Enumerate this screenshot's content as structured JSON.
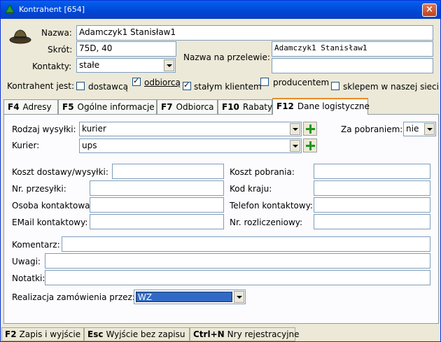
{
  "window": {
    "title": "Kontrahent [654]",
    "close": "×"
  },
  "header": {
    "nazwa_label": "Nazwa:",
    "nazwa_value": "Adamczyk1 Stanisław1",
    "skrot_label": "Skrót:",
    "skrot_value": "75D, 40",
    "kontakty_label": "Kontakty:",
    "kontakty_value": "stałe",
    "przelew_label": "Nazwa na przelewie:",
    "przelew_value": "Adamczyk1 Stanisław1",
    "przelew_value2": ""
  },
  "kontrahent_jest": {
    "label": "Kontrahent jest:",
    "options": [
      {
        "label": "dostawcą",
        "checked": false
      },
      {
        "label": "odbiorcą",
        "checked": true
      },
      {
        "label": "stałym klientem",
        "checked": true
      },
      {
        "label": "producentem",
        "checked": false
      },
      {
        "label": "sklepem w naszej sieci",
        "checked": false
      }
    ]
  },
  "tabs": [
    {
      "key": "F4",
      "label": "Adresy"
    },
    {
      "key": "F5",
      "label": "Ogólne informacje"
    },
    {
      "key": "F7",
      "label": "Odbiorca"
    },
    {
      "key": "F10",
      "label": "Rabaty"
    },
    {
      "key": "F12",
      "label": "Dane logistyczne"
    }
  ],
  "logistics": {
    "rodzaj_label": "Rodzaj wysyłki:",
    "rodzaj_value": "kurier",
    "kurier_label": "Kurier:",
    "kurier_value": "ups",
    "pobranie_label": "Za pobraniem:",
    "pobranie_value": "nie",
    "koszt_dostawy_label": "Koszt dostawy/wysyłki:",
    "koszt_dostawy_value": "",
    "koszt_pobrania_label": "Koszt pobrania:",
    "koszt_pobrania_value": "",
    "nr_przesylki_label": "Nr. przesyłki:",
    "nr_przesylki_value": "",
    "kod_kraju_label": "Kod kraju:",
    "kod_kraju_value": "",
    "osoba_label": "Osoba kontaktowa:",
    "osoba_value": "",
    "telefon_label": "Telefon kontaktowy:",
    "telefon_value": "",
    "email_label": "EMail kontaktowy:",
    "email_value": "",
    "nr_rozl_label": "Nr. rozliczeniowy:",
    "nr_rozl_value": "",
    "komentarz_label": "Komentarz:",
    "komentarz_value": "",
    "uwagi_label": "Uwagi:",
    "uwagi_value": "",
    "notatki_label": "Notatki:",
    "notatki_value": "",
    "realizacja_label": "Realizacja zamówienia przez:",
    "realizacja_value": "WZ"
  },
  "status": [
    {
      "key": "F2",
      "label": "Zapis i wyjście"
    },
    {
      "key": "Esc",
      "label": "Wyjście bez zapisu"
    },
    {
      "key": "Ctrl+N",
      "label": "Nry rejestracyjne"
    }
  ]
}
